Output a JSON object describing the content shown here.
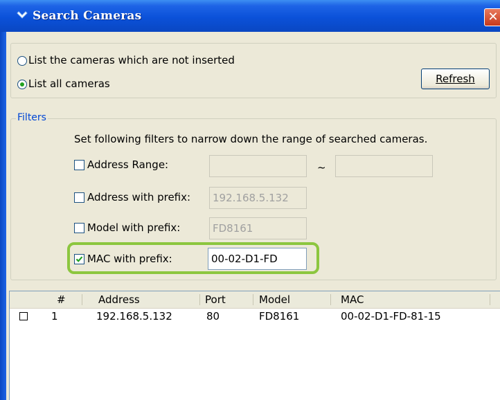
{
  "window": {
    "title": "Search Cameras",
    "close_glyph": "✕",
    "icon": "camera-search-icon"
  },
  "mode": {
    "option_not_inserted": "List the cameras which are not inserted",
    "option_all": "List all cameras",
    "selected": "option_all",
    "refresh_label": "Refresh"
  },
  "filters": {
    "group_label": "Filters",
    "description": "Set following filters to narrow down the range of searched cameras.",
    "address_range": {
      "label": "Address Range:",
      "checked": false,
      "from_value": "",
      "to_value": "",
      "separator": "~"
    },
    "address_prefix": {
      "label": "Address with prefix:",
      "checked": false,
      "value": "192.168.5.132"
    },
    "model_prefix": {
      "label": "Model with prefix:",
      "checked": false,
      "value": "FD8161"
    },
    "mac_prefix": {
      "label": "MAC with prefix:",
      "checked": true,
      "value": "00-02-D1-FD"
    },
    "highlight_color": "#8cc63f"
  },
  "results": {
    "columns": [
      "#",
      "Address",
      "Port",
      "Model",
      "MAC"
    ],
    "rows": [
      {
        "checked": false,
        "index": "1",
        "address": "192.168.5.132",
        "port": "80",
        "model": "FD8161",
        "mac": "00-02-D1-FD-81-15"
      }
    ]
  }
}
